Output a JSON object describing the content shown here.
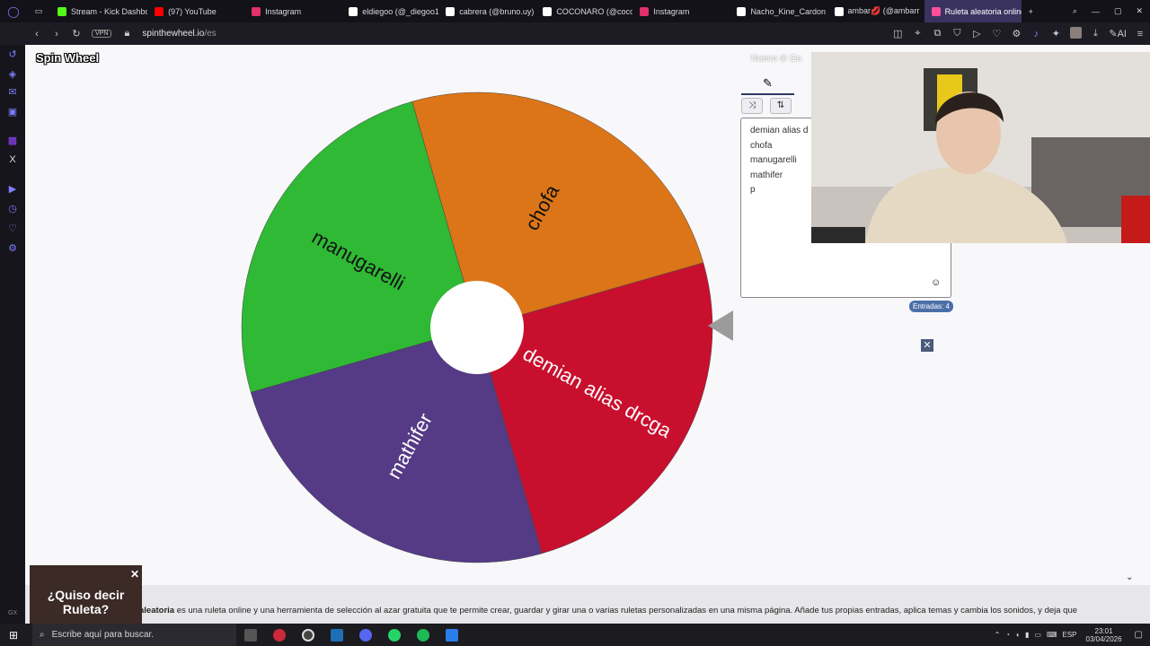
{
  "browser": {
    "tabs": [
      {
        "label": "Stream - Kick Dashbo",
        "color": "#53fc18"
      },
      {
        "label": "(97) YouTube",
        "color": "#ff0000"
      },
      {
        "label": "Instagram",
        "color": "#e1306c"
      },
      {
        "label": "eldiegoo (@_diegoo1",
        "color": "#ffffff"
      },
      {
        "label": "cabrera (@bruno.uy)",
        "color": "#ffffff"
      },
      {
        "label": "COCONARO (@coco",
        "color": "#ffffff"
      },
      {
        "label": "Instagram",
        "color": "#e1306c"
      },
      {
        "label": "Nacho_Kine_Cardon",
        "color": "#ffffff"
      },
      {
        "label": "ambar💋 (@ambarr",
        "color": "#ffffff"
      },
      {
        "label": "Ruleta aleatoria online – ru",
        "color": "#ff4f9a"
      }
    ],
    "new_tab": "+",
    "vpn_label": "VPN",
    "url_host": "spinthewheel.io",
    "url_path": "/es",
    "ai_label": "AI"
  },
  "page": {
    "logo": "Spin Wheel",
    "topnav": "Nuevo   ⊕ Gu",
    "entries": [
      "demian alias d",
      "chofa",
      "manugarelli",
      "mathifer",
      "p"
    ],
    "entries_badge": "Entradas: 4",
    "wheel_segments": [
      {
        "label": "demian alias drcga",
        "color": "#c8102e"
      },
      {
        "label": "mathifer",
        "color": "#553a86"
      },
      {
        "label": "manugarelli",
        "color": "#2fb934"
      },
      {
        "label": "chofa",
        "color": "#dc7518"
      }
    ],
    "bottom_text_bold": "aleatoria",
    "bottom_text": " es una ruleta online y una herramienta de selección al azar gratuita que te permite crear, guardar y girar una o varias ruletas personalizadas en una misma página. Añade tus propias entradas, aplica temas y cambia los sonidos, y deja que",
    "ad_text": "¿Quiso decir Ruleta?"
  },
  "taskbar": {
    "search_placeholder": "Escribe aquí para buscar.",
    "lang": "ESP",
    "time": "23:01",
    "date": "03/04/2026"
  }
}
